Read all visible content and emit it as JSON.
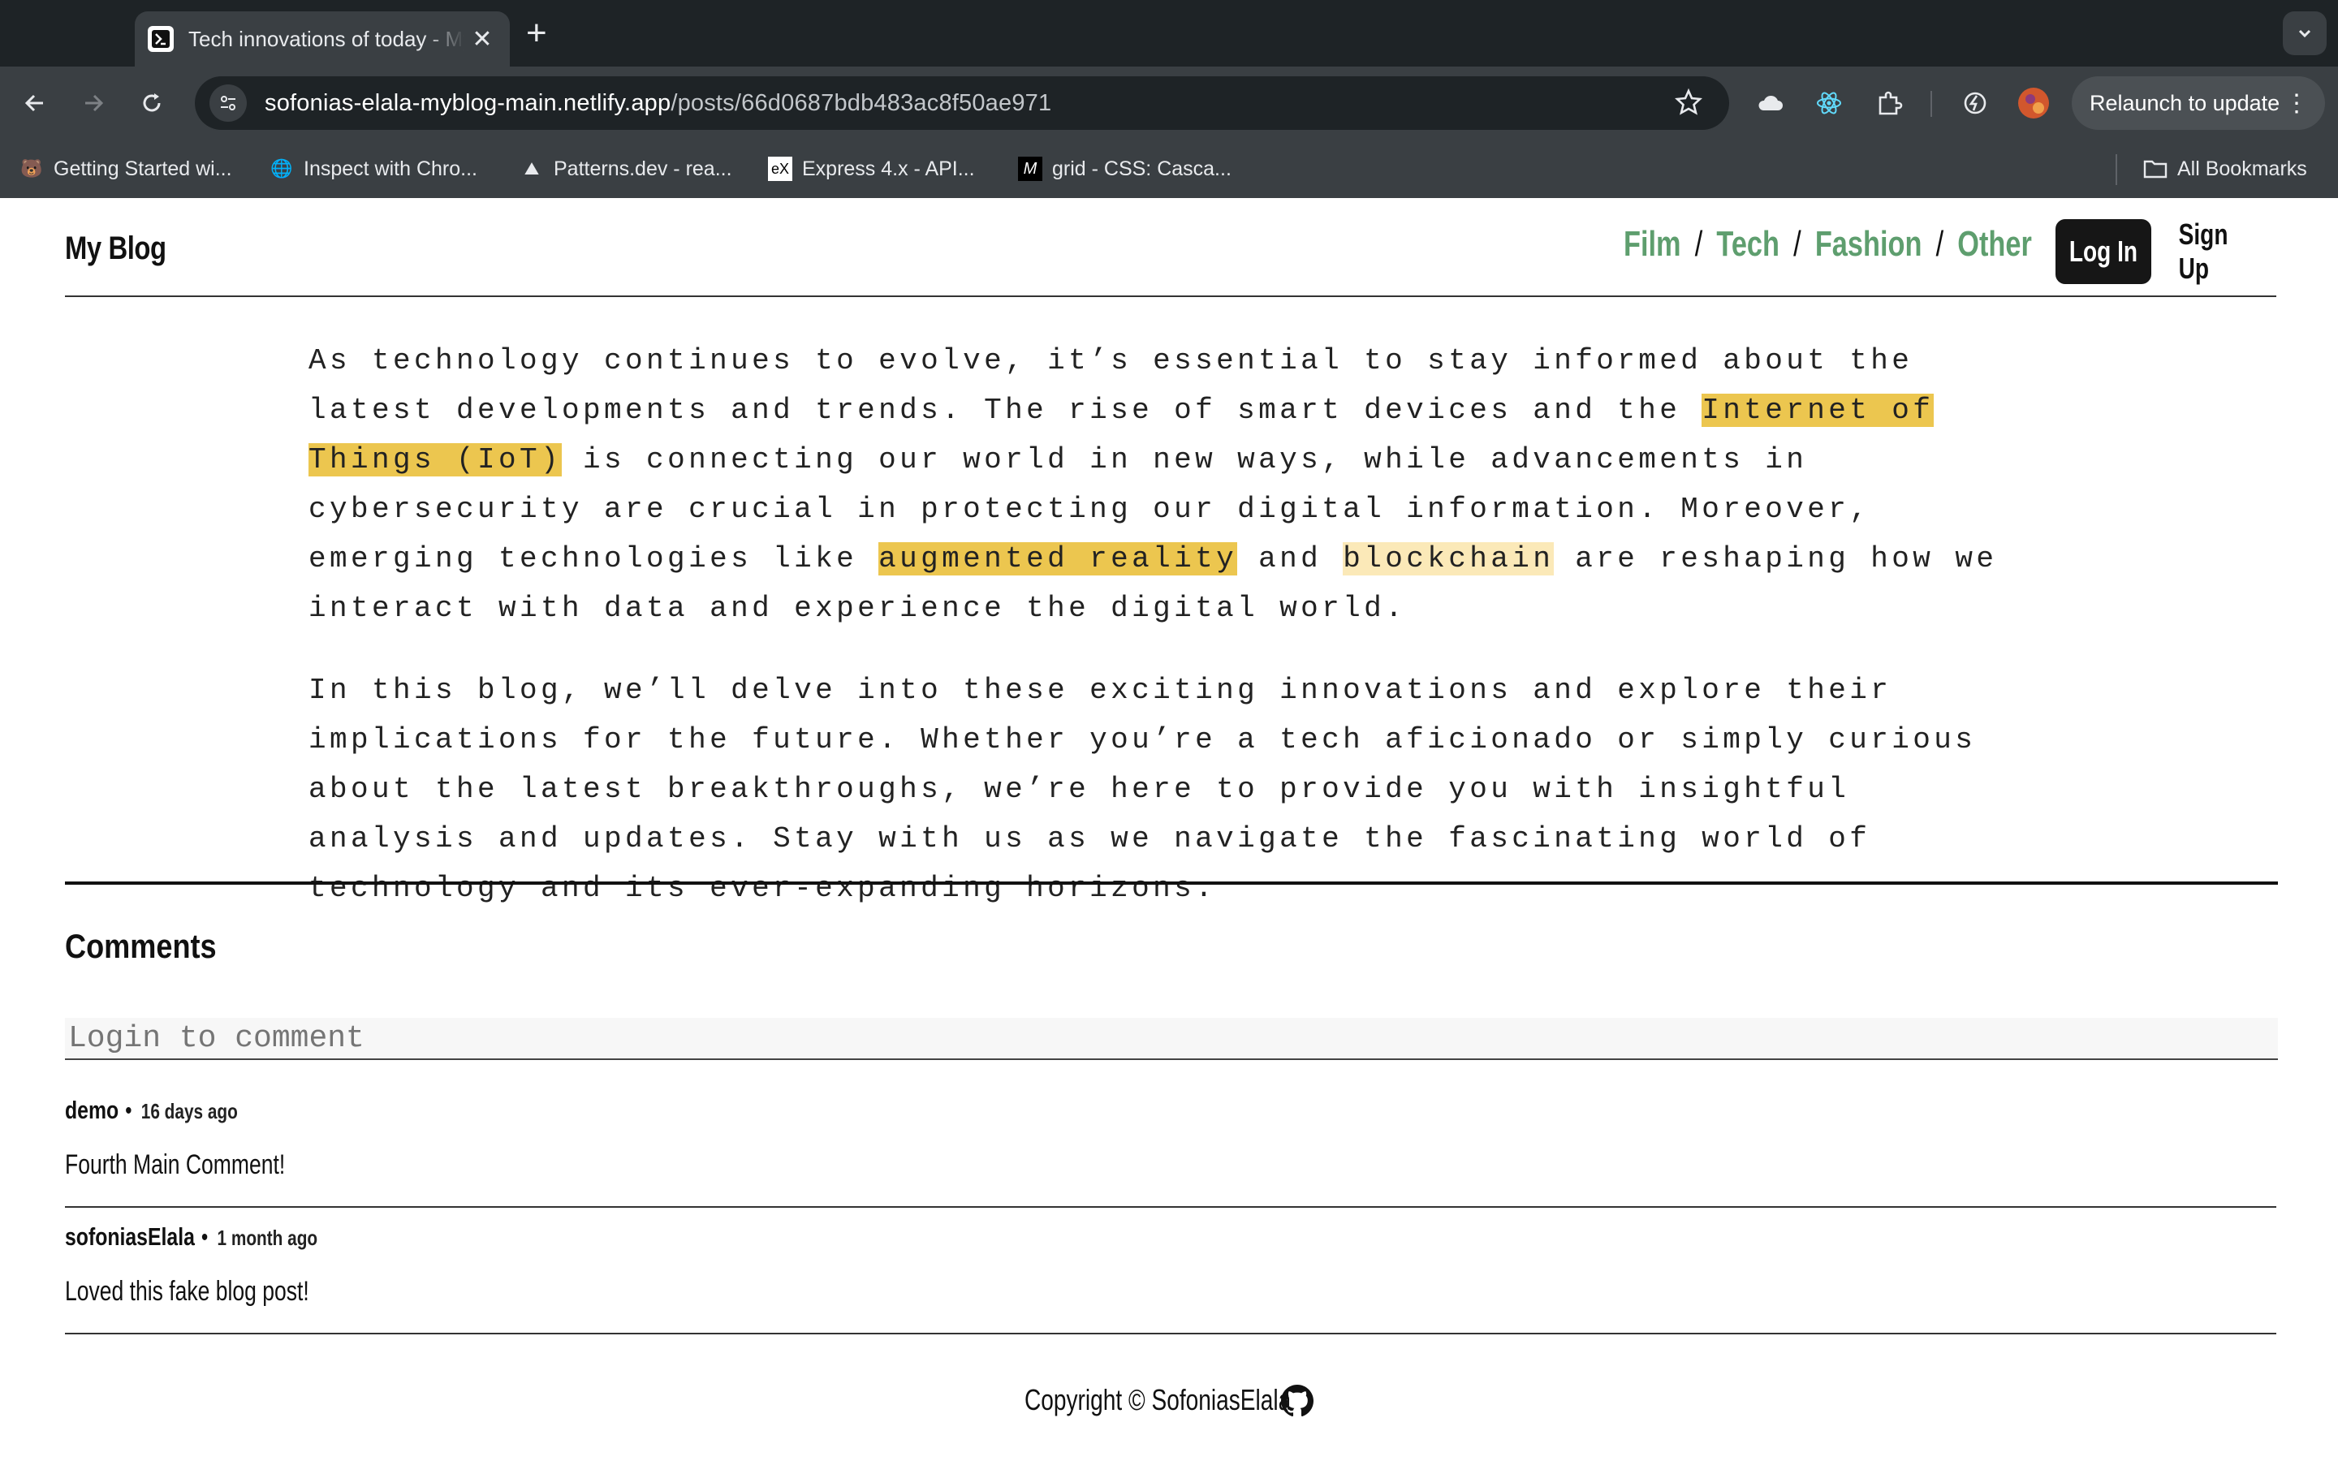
{
  "browser": {
    "tab_title": "Tech innovations of today - My Blog",
    "tab_close": "✕",
    "new_tab": "+",
    "url_host": "sofonias-elala-myblog-main.netlify.app",
    "url_path": "/posts/66d0687bdb483ac8f50ae971",
    "relaunch_label": "Relaunch to update",
    "kebab": "⋮",
    "bookmarks": [
      {
        "label": "Getting Started wi...",
        "icon": "🐻"
      },
      {
        "label": "Inspect with Chro...",
        "icon": "🌐"
      },
      {
        "label": "Patterns.dev - rea...",
        "icon": "⛰"
      },
      {
        "label": "Express 4.x - API...",
        "icon": "eX"
      },
      {
        "label": "grid - CSS: Casca...",
        "icon": "M"
      }
    ],
    "all_bookmarks": "All Bookmarks"
  },
  "site": {
    "brand": "My Blog",
    "nav": {
      "film": "Film",
      "tech": "Tech",
      "fashion": "Fashion",
      "other": "Other",
      "sep": "/"
    },
    "login": "Log In",
    "signup": "Sign Up",
    "accent_color": "#5e9e6e"
  },
  "article": {
    "p1_a": "As technology continues to evolve, it’s essential to stay informed about the latest developments and trends. The rise of smart devices and the ",
    "p1_hl1": "Internet of Things (IoT)",
    "p1_b": " is connecting our world in new ways, while advancements in cybersecurity are crucial in protecting our digital information. Moreover, emerging technologies like ",
    "p1_hl2": "augmented reality",
    "p1_c": " and ",
    "p1_hl3": "blockchain",
    "p1_d": " are reshaping how we interact with data and experience the digital world.",
    "p2": "In this blog, we’ll delve into these exciting innovations and explore their implications for the future. Whether you’re a tech aficionado or simply curious about the latest breakthroughs, we’re here to provide you with insightful analysis and updates. Stay with us as we navigate the fascinating world of technology and its ever-expanding horizons."
  },
  "comments": {
    "title": "Comments",
    "placeholder": "Login to comment",
    "dot": "•",
    "items": [
      {
        "user": "demo",
        "time": "16 days ago",
        "body": "Fourth Main Comment!"
      },
      {
        "user": "sofoniasElala",
        "time": "1 month ago",
        "body": "Loved this fake blog post!"
      }
    ]
  },
  "footer": {
    "text": "Copyright © SofoniasElala",
    "icon": "github-icon"
  }
}
